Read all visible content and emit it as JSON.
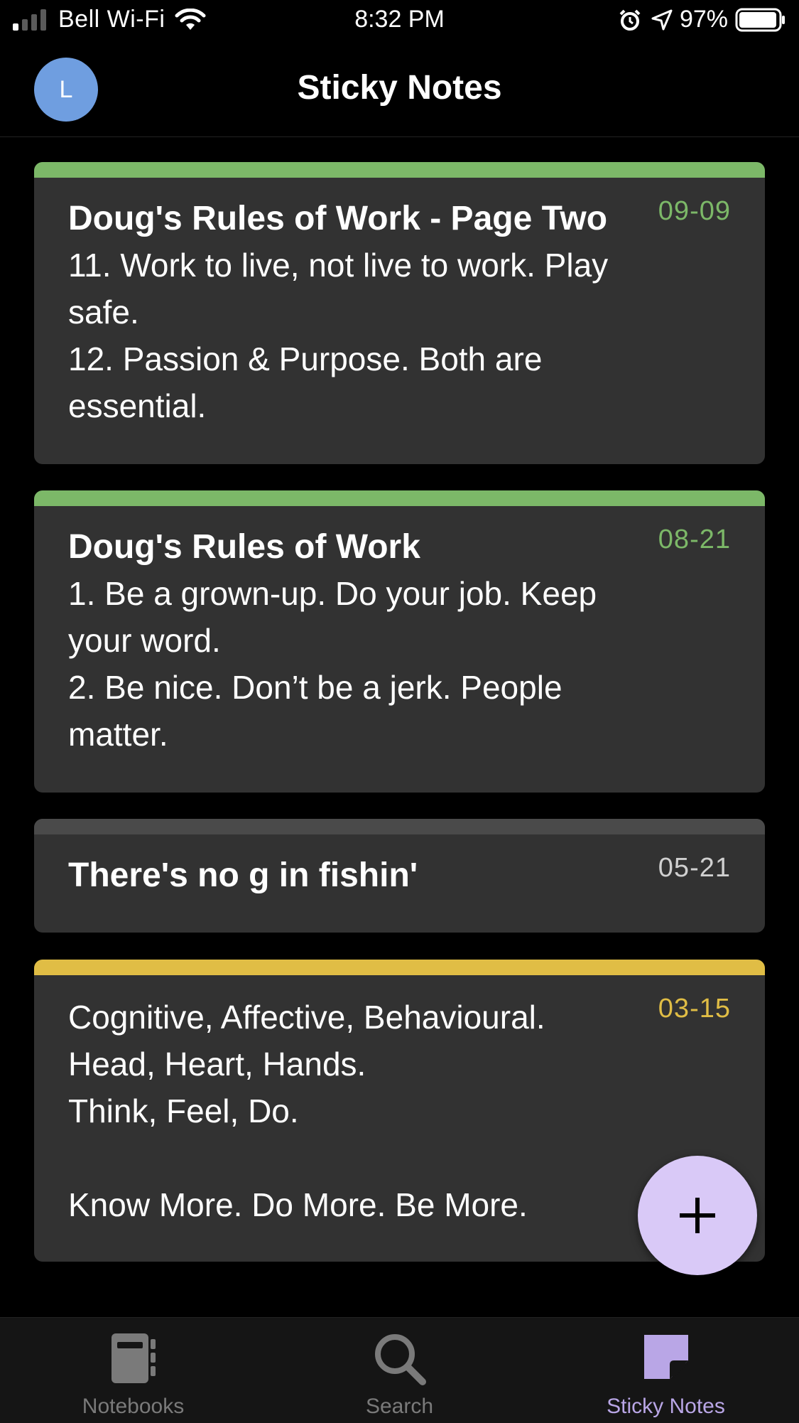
{
  "status_bar": {
    "carrier": "Bell Wi-Fi",
    "time": "8:32 PM",
    "battery": "97%"
  },
  "nav": {
    "avatar_letter": "L",
    "title": "Sticky Notes"
  },
  "notes": [
    {
      "title": "Doug's Rules of Work - Page Two",
      "body": "11. Work to live, not live to work. Play safe.\n12. Passion & Purpose. Both are essential.",
      "date": "09-09",
      "color": "#7cb868"
    },
    {
      "title": "Doug's Rules of Work",
      "body": "1. Be a grown-up. Do your job. Keep your word.\n2. Be nice. Don’t be a jerk. People matter.",
      "date": "08-21",
      "color": "#7cb868"
    },
    {
      "title": "There's no g in fishin'",
      "body": "",
      "date": "05-21",
      "color": "#4a4a4a"
    },
    {
      "title": "",
      "body": "Cognitive, Affective, Behavioural.\nHead, Heart, Hands.\nThink, Feel, Do.\n\nKnow More. Do More. Be More.",
      "date": "03-15",
      "color": "#e0bd45"
    }
  ],
  "fab": {
    "icon": "plus-icon"
  },
  "tabs": [
    {
      "label": "Notebooks",
      "icon": "notebook-icon",
      "active": false
    },
    {
      "label": "Search",
      "icon": "search-icon",
      "active": false
    },
    {
      "label": "Sticky Notes",
      "icon": "sticky-note-icon",
      "active": true
    }
  ],
  "colors": {
    "tab_inactive": "#7a7a7a",
    "tab_active": "#b9a6e6",
    "date_neutral": "#d0d0d0"
  }
}
